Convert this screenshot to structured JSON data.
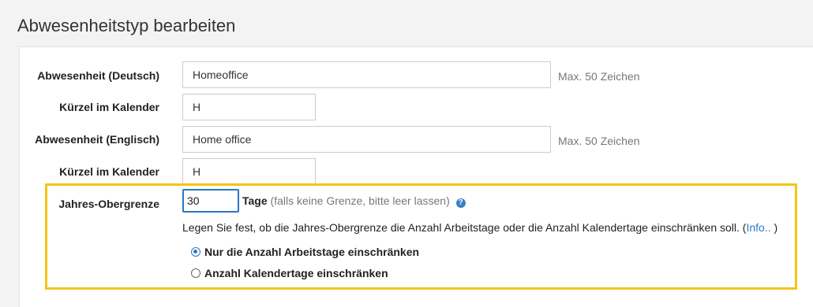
{
  "page": {
    "title": "Abwesenheitstyp bearbeiten"
  },
  "fields": {
    "absence_de": {
      "label": "Abwesenheit (Deutsch)",
      "value": "Homeoffice",
      "hint": "Max. 50 Zeichen"
    },
    "short_de": {
      "label": "Kürzel im Kalender",
      "value": "H"
    },
    "absence_en": {
      "label": "Abwesenheit (Englisch)",
      "value": "Home office",
      "hint": "Max. 50 Zeichen"
    },
    "short_en": {
      "label": "Kürzel im Kalender",
      "value": "H"
    }
  },
  "yearly_limit": {
    "label": "Jahres-Obergrenze",
    "value": "30",
    "unit": "Tage",
    "note": "(falls keine Grenze, bitte leer lassen)",
    "help_icon": "question-circle-icon",
    "description": "Legen Sie fest, ob die Jahres-Obergrenze die Anzahl Arbeitstage oder die Anzahl Kalendertage einschränken soll.",
    "info_open": "(",
    "info_link": "Info..",
    "info_close": " )",
    "options": [
      {
        "label": "Nur die Anzahl Arbeitstage einschränken",
        "selected": true
      },
      {
        "label": "Anzahl Kalendertage einschränken",
        "selected": false
      }
    ]
  },
  "colors": {
    "accent": "#2b77c2",
    "highlight": "#f5c518"
  }
}
